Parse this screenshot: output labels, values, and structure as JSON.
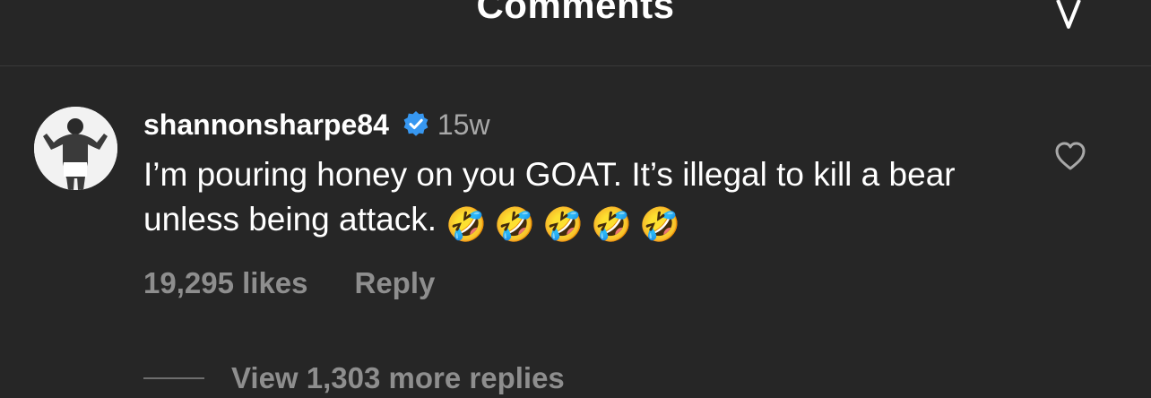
{
  "header": {
    "title": "Comments",
    "filter_icon": "filter-icon"
  },
  "comment": {
    "username": "shannonsharpe84",
    "verified_icon": "verified-badge-icon",
    "time": "15w",
    "text": "I’m pouring honey on you GOAT. It’s illegal to kill a bear unless being attack.",
    "emojis": "🤣🤣🤣🤣🤣",
    "likes": "19,295 likes",
    "reply_label": "Reply",
    "view_replies": "View 1,303 more replies",
    "heart_icon": "heart-outline-icon"
  },
  "colors": {
    "background": "#262626",
    "text_primary": "#ffffff",
    "text_secondary": "#8e8e8e",
    "verified": "#3797f0"
  }
}
